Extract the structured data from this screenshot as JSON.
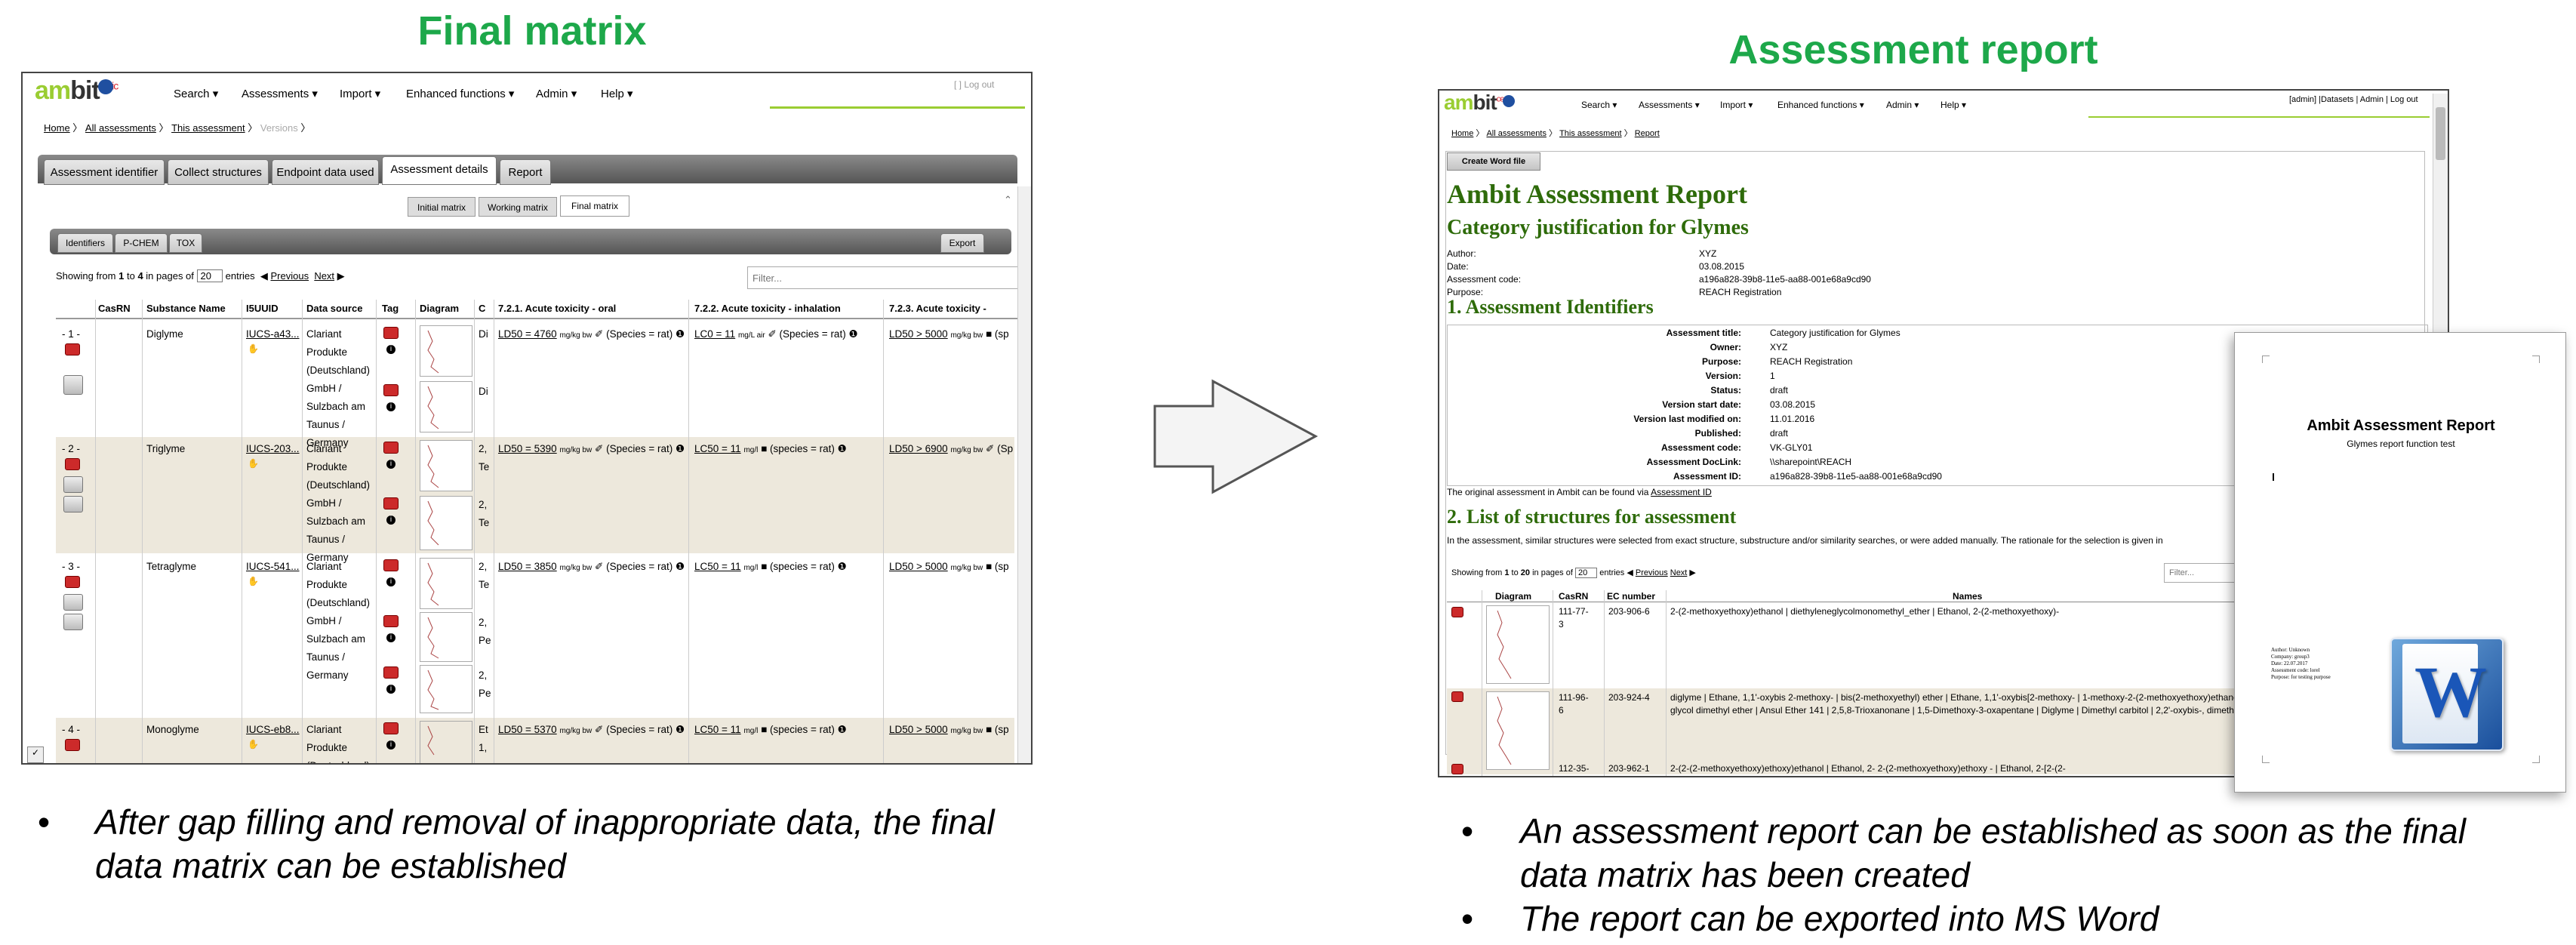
{
  "left": {
    "heading": "Final matrix",
    "bullet": "After gap filling and removal of inappropriate data, the final",
    "bullet2": "data matrix can be established",
    "app": {
      "logo_a": "am",
      "logo_b": "bit",
      "logo_c": "ceric",
      "nav": [
        "Search",
        "Assessments",
        "Import",
        "Enhanced functions",
        "Admin",
        "Help"
      ],
      "login": "[ ]  Log out",
      "breadcrumb": [
        "Home",
        "All assessments",
        "This assessment",
        "Versions"
      ],
      "tabs": [
        "Assessment identifier",
        "Collect structures",
        "Endpoint data used",
        "Assessment details",
        "Report"
      ],
      "subtabs": [
        "Initial matrix",
        "Working matrix",
        "Final matrix"
      ],
      "inner_tabs": [
        "Identifiers",
        "P-CHEM",
        "TOX"
      ],
      "export": "Export",
      "showing_pre": "Showing from",
      "showing_a": "1",
      "showing_to": "to",
      "showing_b": "4",
      "showing_post": "in pages of",
      "page_size": "20",
      "entries": "entries",
      "previous": "Previous",
      "next": "Next",
      "filter_placeholder": "Filter...",
      "columns": [
        "",
        "CasRN",
        "Substance Name",
        "I5UUID",
        "Data source",
        "Tag",
        "Diagram",
        "C",
        "7.2.1. Acute toxicity - oral",
        "7.2.2. Acute toxicity - inhalation",
        "7.2.3. Acute toxicity -"
      ],
      "rows": [
        {
          "num": "- 1 -",
          "name": "Diglyme",
          "uuid": "IUCS-a43...",
          "src": [
            "Clariant",
            "Produkte",
            "(Deutschland)",
            "GmbH /",
            "Sulzbach am",
            "Taunus /",
            "Germany"
          ],
          "c": [
            "Di",
            "Di"
          ],
          "oral": "LD50 = 4760",
          "oral_unit": "mg/kg bw",
          "oral_sp": "(Species = rat)",
          "inh": "LC0 = 11",
          "inh_unit": "mg/L air",
          "inh_sp": "(Species = rat)",
          "derm": "LD50 > 5000",
          "derm_unit": "mg/kg bw",
          "derm_sp": "(sp"
        },
        {
          "num": "- 2 -",
          "name": "Triglyme",
          "uuid": "IUCS-203...",
          "src": [
            "Clariant",
            "Produkte",
            "(Deutschland)",
            "GmbH /",
            "Sulzbach am",
            "Taunus /",
            "Germany"
          ],
          "c": [
            "2,",
            "Te",
            "2,",
            "Te"
          ],
          "oral": "LD50 = 5390",
          "oral_unit": "mg/kg bw",
          "oral_sp": "(Species = rat)",
          "inh": "LC50 = 11",
          "inh_unit": "mg/l",
          "inh_sp": "(species = rat)",
          "derm": "LD50 > 6900",
          "derm_unit": "mg/kg bw",
          "derm_sp": "(Sp"
        },
        {
          "num": "- 3 -",
          "name": "Tetraglyme",
          "uuid": "IUCS-541...",
          "src": [
            "Clariant",
            "Produkte",
            "(Deutschland)",
            "GmbH /",
            "Sulzbach am",
            "Taunus /",
            "Germany"
          ],
          "c": [
            "2,",
            "Te",
            "2,",
            "Pe",
            "2,",
            "Pe"
          ],
          "oral": "LD50 = 3850",
          "oral_unit": "mg/kg bw",
          "oral_sp": "(Species = rat)",
          "inh": "LC50 = 11",
          "inh_unit": "mg/l",
          "inh_sp": "(species = rat)",
          "derm": "LD50 > 5000",
          "derm_unit": "mg/kg bw",
          "derm_sp": "(sp"
        },
        {
          "num": "- 4 -",
          "name": "Monoglyme",
          "uuid": "IUCS-eb8...",
          "src": [
            "Clariant",
            "Produkte",
            "(Deutschland)"
          ],
          "c": [
            "Et",
            "1,"
          ],
          "oral": "LD50 = 5370",
          "oral_unit": "mg/kg bw",
          "oral_sp": "(Species = rat)",
          "inh": "LC50 = 11",
          "inh_unit": "mg/l",
          "inh_sp": "(species = rat)",
          "derm": "LD50 > 5000",
          "derm_unit": "mg/kg bw",
          "derm_sp": "(sp"
        }
      ]
    }
  },
  "right": {
    "heading": "Assessment report",
    "bullet1a": "An assessment report can be established as soon as the final",
    "bullet1b": "data matrix has been created",
    "bullet2": "The report can be exported into MS Word",
    "app": {
      "nav": [
        "Search",
        "Assessments",
        "Import",
        "Enhanced functions",
        "Admin",
        "Help"
      ],
      "toplinks": "[admin]  |Datasets  | Admin | Log out",
      "breadcrumb": [
        "Home",
        "All assessments",
        "This assessment",
        "Report"
      ],
      "create_word": "Create Word file",
      "title": "Ambit Assessment Report",
      "subtitle": "Category justification for Glymes",
      "meta": [
        {
          "k": "Author:",
          "v": "XYZ"
        },
        {
          "k": "Date:",
          "v": "03.08.2015"
        },
        {
          "k": "Assessment code:",
          "v": "a196a828-39b8-11e5-aa88-001e68a9cd90"
        },
        {
          "k": "Purpose:",
          "v": "REACH Registration"
        }
      ],
      "section1": "1. Assessment Identifiers",
      "ident": [
        {
          "k": "Assessment title:",
          "v": "Category justification for Glymes"
        },
        {
          "k": "Owner:",
          "v": "XYZ"
        },
        {
          "k": "Purpose:",
          "v": "REACH Registration"
        },
        {
          "k": "Version:",
          "v": "1"
        },
        {
          "k": "Status:",
          "v": "draft"
        },
        {
          "k": "Version start date:",
          "v": "03.08.2015"
        },
        {
          "k": "Version last modified on:",
          "v": "11.01.2016"
        },
        {
          "k": "Published:",
          "v": "draft"
        },
        {
          "k": "Assessment code:",
          "v": "VK-GLY01"
        },
        {
          "k": "Assessment DocLink:",
          "v": "\\\\sharepoint\\REACH"
        },
        {
          "k": "Assessment ID:",
          "v": "a196a828-39b8-11e5-aa88-001e68a9cd90"
        }
      ],
      "original_note": "The original assessment in Ambit can be found via",
      "original_link": "Assessment ID",
      "section2": "2. List of structures for assessment",
      "section2_text": "In the assessment, similar structures were selected from exact structure, substructure and/or similarity searches, or were added manually. The rationale for the selection is given in",
      "showing_pre": "Showing from",
      "showing_a": "1",
      "showing_to": "to",
      "showing_b": "20",
      "showing_post": "in pages of",
      "page_size": "20",
      "entries": "entries",
      "previous": "Previous",
      "next": "Next",
      "filter_placeholder": "Filter...",
      "columns": [
        "",
        "Diagram",
        "CasRN",
        "EC number",
        "Names"
      ],
      "rows": [
        {
          "cas": [
            "111-77-",
            "3"
          ],
          "ec": "203-906-6",
          "names": "2-(2-methoxyethoxy)ethanol | diethyleneglycolmonomethyl_ether | Ethanol, 2-(2-methoxyethoxy)-"
        },
        {
          "cas": [
            "111-96-",
            "6"
          ],
          "ec": "203-924-4",
          "names": "diglyme | Ethane, 1,1'-oxybis 2-methoxy- | bis(2-methoxyethyl) ether | Ethane, 1,1'-oxybis[2-methoxy- | 1-methoxy-2-(2-methoxyethoxy)ethane | 1,1'-Oxybis[2-methoxyethane] | Diethylene glycol dimethyl ether | Ansul Ether 141 | 2,5,8-Trioxanonane | 1,5-Dimethoxy-3-oxapentane | Diglyme | Dimethyl carbitol | 2,2'-oxybis-, dimethyl ether | Dimethyl digol"
        },
        {
          "cas": [
            "112-35-"
          ],
          "ec": "203-962-1",
          "names": "2-(2-(2-methoxyethoxy)ethoxy)ethanol | Ethanol, 2- 2-(2-methoxyethoxy)ethoxy - | Ethanol, 2-[2-(2-"
        }
      ]
    },
    "word": {
      "title": "Ambit Assessment Report",
      "subtitle": "Glymes report function test",
      "small": [
        "Author: Unknown",
        "Company: group3",
        "Date: 22.07.2017",
        "Assessment code: lorel",
        "Purpose: for testing purpose"
      ],
      "logo": "W"
    }
  }
}
